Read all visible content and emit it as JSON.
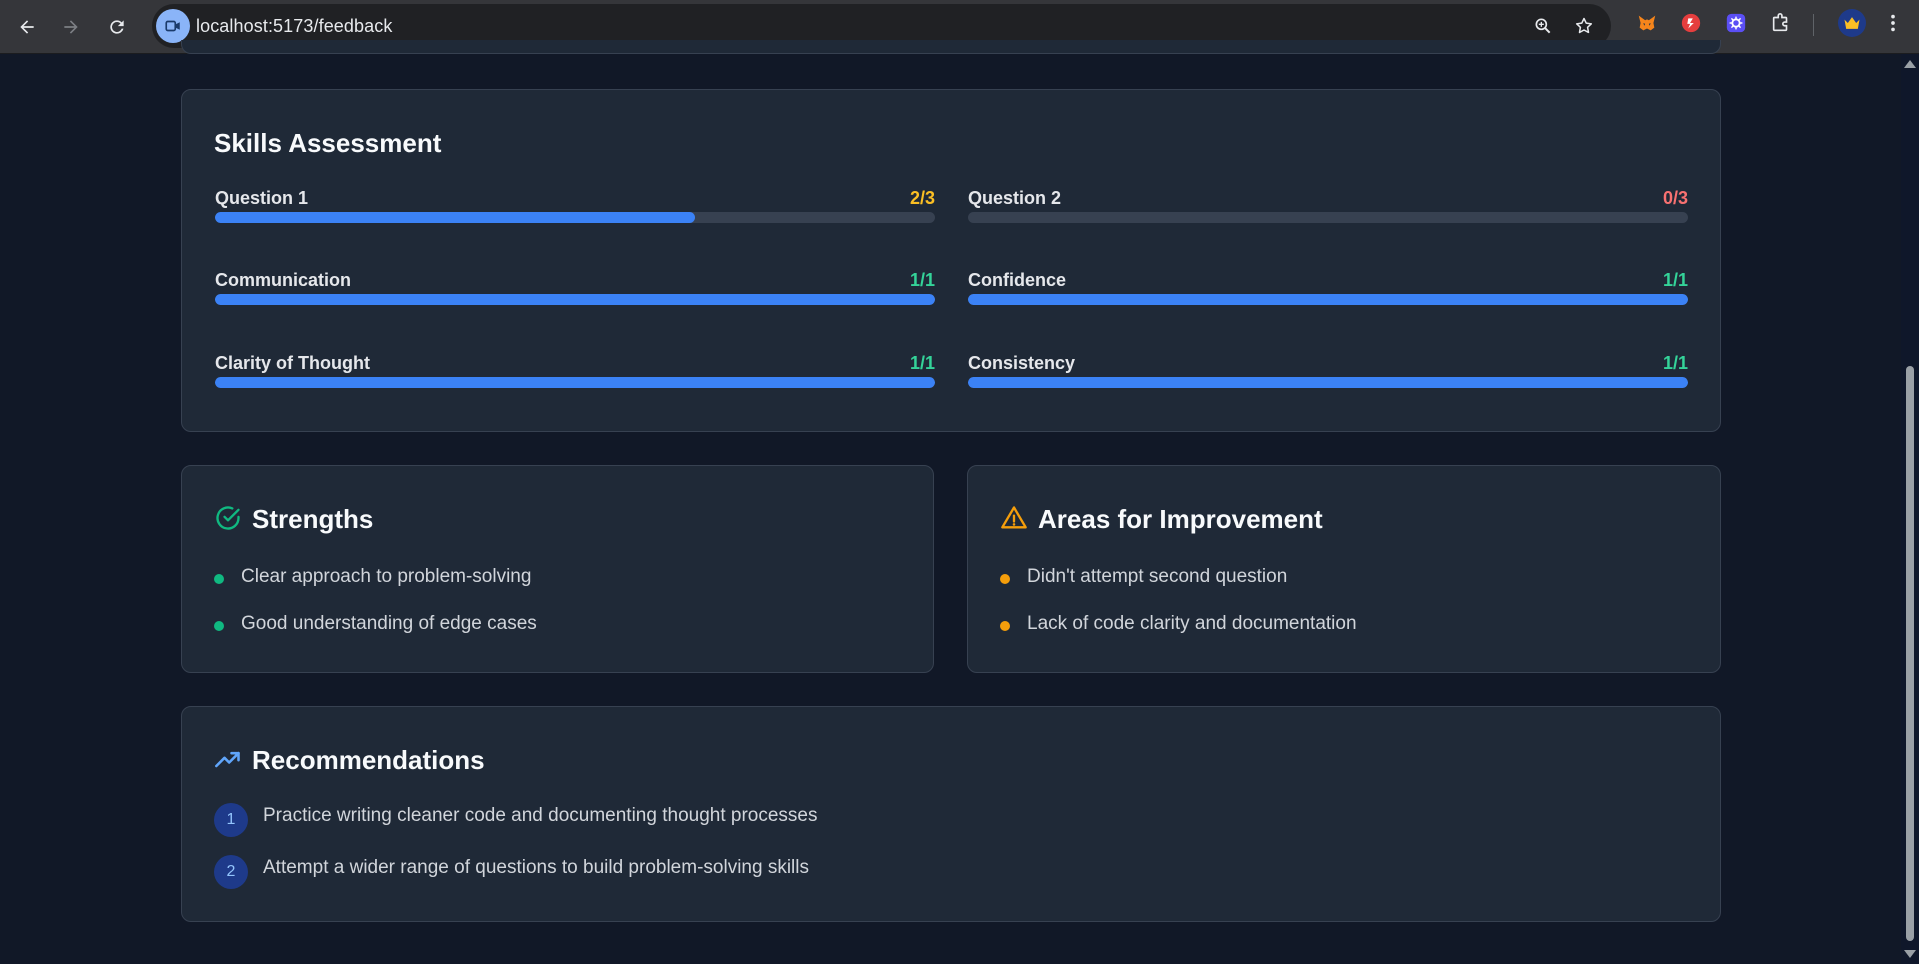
{
  "browser": {
    "url": "localhost:5173/feedback"
  },
  "skills": {
    "title": "Skills Assessment",
    "items": [
      {
        "name": "Question 1",
        "score": "2/3",
        "fraction": 0.667,
        "color": "#fbbf24"
      },
      {
        "name": "Question 2",
        "score": "0/3",
        "fraction": 0,
        "color": "#f87171"
      },
      {
        "name": "Communication",
        "score": "1/1",
        "fraction": 1,
        "color": "#34d399"
      },
      {
        "name": "Confidence",
        "score": "1/1",
        "fraction": 1,
        "color": "#34d399"
      },
      {
        "name": "Clarity of Thought",
        "score": "1/1",
        "fraction": 1,
        "color": "#34d399"
      },
      {
        "name": "Consistency",
        "score": "1/1",
        "fraction": 1,
        "color": "#34d399"
      }
    ]
  },
  "strengths": {
    "title": "Strengths",
    "icon": "check-circle-icon",
    "items": [
      "Clear approach to problem-solving",
      "Good understanding of edge cases"
    ]
  },
  "improvements": {
    "title": "Areas for Improvement",
    "icon": "warning-triangle-icon",
    "items": [
      "Didn't attempt second question",
      "Lack of code clarity and documentation"
    ]
  },
  "recommendations": {
    "title": "Recommendations",
    "icon": "trending-up-icon",
    "items": [
      {
        "num": "1",
        "text": "Practice writing cleaner code and documenting thought processes"
      },
      {
        "num": "2",
        "text": "Attempt a wider range of questions to build problem-solving skills"
      }
    ]
  },
  "colors": {
    "accent": "#3b82f6",
    "success": "#10b981",
    "warning": "#f59e0b",
    "card": "#1f2937",
    "background": "#111827"
  }
}
